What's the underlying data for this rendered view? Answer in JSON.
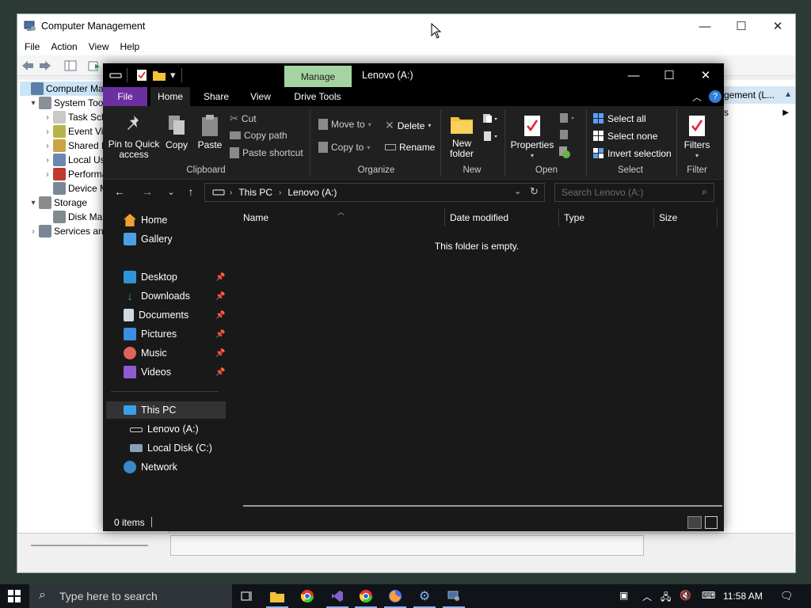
{
  "cm": {
    "title": "Computer Management",
    "menu": [
      "File",
      "Action",
      "View",
      "Help"
    ],
    "tree": [
      {
        "label": "Computer Mana",
        "expander": "",
        "color": "#5b7fa8",
        "selected": true
      },
      {
        "label": "System Tools",
        "expander": "▾",
        "color": "#8a9099"
      },
      {
        "label": "Task Sch",
        "expander": "›",
        "color": "#c9c9c9"
      },
      {
        "label": "Event Vie",
        "expander": "›",
        "color": "#b5b54b"
      },
      {
        "label": "Shared F",
        "expander": "›",
        "color": "#c9a440"
      },
      {
        "label": "Local Us",
        "expander": "›",
        "color": "#6d86b2"
      },
      {
        "label": "Performa",
        "expander": "›",
        "color": "#c0392b"
      },
      {
        "label": "Device M",
        "expander": "",
        "color": "#7a8796"
      },
      {
        "label": "Storage",
        "expander": "▾",
        "color": "#8b8b8b"
      },
      {
        "label": "Disk Mar",
        "expander": "",
        "color": "#7f8c8d"
      },
      {
        "label": "Services and",
        "expander": "›",
        "color": "#7a8796"
      }
    ],
    "actions_header": "gement (L...",
    "actions_item": "s"
  },
  "fe": {
    "title": "Lenovo (A:)",
    "manage_tab": "Manage",
    "tabs": [
      "File",
      "Home",
      "Share",
      "View",
      "Drive Tools"
    ],
    "ribbon": {
      "pin_label": "Pin to Quick access",
      "copy_label": "Copy",
      "paste_label": "Paste",
      "cut_label": "Cut",
      "copy_path_label": "Copy path",
      "paste_shortcut_label": "Paste shortcut",
      "clipboard_group": "Clipboard",
      "move_to_label": "Move to",
      "copy_to_label": "Copy to",
      "delete_label": "Delete",
      "rename_label": "Rename",
      "organize_group": "Organize",
      "new_folder_label": "New folder",
      "new_group": "New",
      "properties_label": "Properties",
      "open_group": "Open",
      "select_all_label": "Select all",
      "select_none_label": "Select none",
      "invert_selection_label": "Invert selection",
      "select_group": "Select",
      "filters_label": "Filters",
      "filter_group": "Filter"
    },
    "address": {
      "segments": [
        "This PC",
        "Lenovo (A:)"
      ]
    },
    "search_placeholder": "Search Lenovo (A:)",
    "nav": {
      "home": "Home",
      "gallery": "Gallery",
      "quick": [
        "Desktop",
        "Downloads",
        "Documents",
        "Pictures",
        "Music",
        "Videos"
      ],
      "this_pc": "This PC",
      "lenovo": "Lenovo (A:)",
      "local_disk": "Local Disk (C:)",
      "network": "Network"
    },
    "columns": [
      "Name",
      "Date modified",
      "Type",
      "Size"
    ],
    "empty_message": "This folder is empty.",
    "status": "0 items"
  },
  "taskbar": {
    "search_placeholder": "Type here to search",
    "clock": "11:58 AM"
  }
}
